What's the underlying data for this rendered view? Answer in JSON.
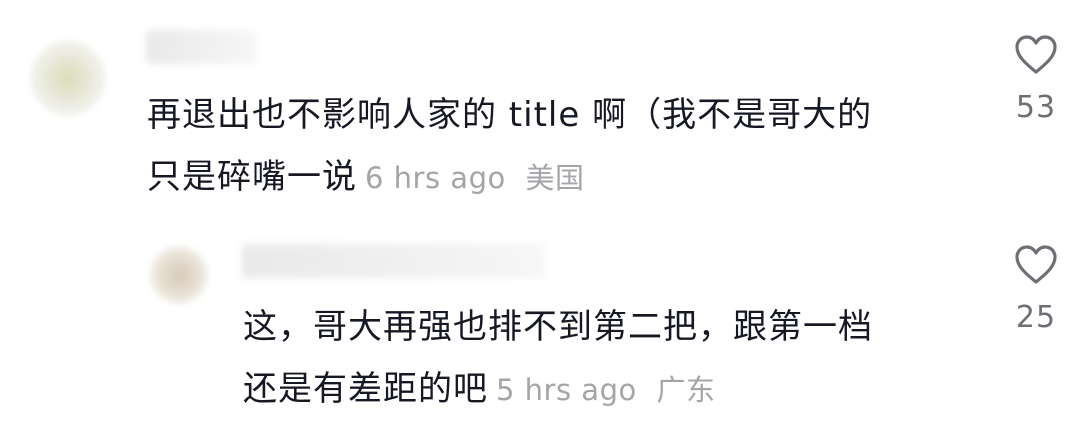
{
  "comments": [
    {
      "line1": "再退出也不影响人家的 title 啊（我不是哥大的",
      "line2": "只是碎嘴一说",
      "time": "6 hrs ago",
      "location": "美国",
      "likes": "53",
      "icon": "heart-outline-icon"
    },
    {
      "line1": "这，哥大再强也排不到第二把，跟第一档",
      "line2": "还是有差距的吧",
      "time": "5 hrs ago",
      "location": "广东",
      "likes": "25",
      "icon": "heart-outline-icon"
    }
  ],
  "colors": {
    "text": "#161823",
    "meta": "#a4a5a9",
    "icon": "#6e6f75"
  }
}
